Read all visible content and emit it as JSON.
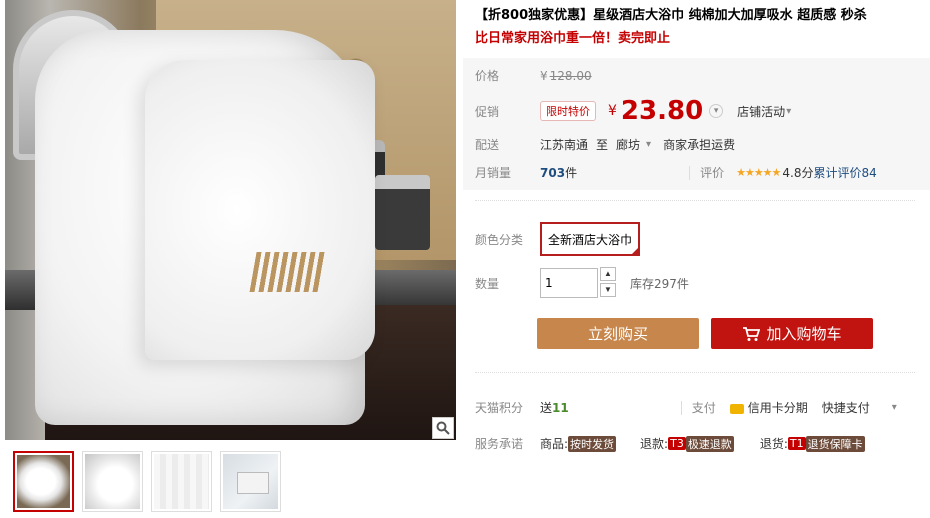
{
  "title": {
    "line1": "【折800独家优惠】星级酒店大浴巾 纯棉加大加厚吸水 超质感 秒杀",
    "line2": "比日常家用浴巾重一倍！卖完即止"
  },
  "price": {
    "label": "价格",
    "currency": "¥",
    "original": "128.00"
  },
  "promo": {
    "label": "促销",
    "badge": "限时特价",
    "currency": "¥",
    "value": "23.80",
    "store_activity": "店铺活动"
  },
  "shipping": {
    "label": "配送",
    "from": "江苏南通",
    "to_word": "至",
    "to": "廊坊",
    "fee": "商家承担运费"
  },
  "sales": {
    "label": "月销量",
    "count": "703",
    "unit": "件",
    "review_label": "评价",
    "stars": "★★★★★",
    "score": "4.8分",
    "review_count": "累计评价84"
  },
  "sku": {
    "label": "颜色分类",
    "option": "全新酒店大浴巾"
  },
  "quantity": {
    "label": "数量",
    "value": "1",
    "stock": "库存297件"
  },
  "actions": {
    "buy_now": "立刻购买",
    "add_cart": "加入购物车"
  },
  "points": {
    "label": "天猫积分",
    "prefix": "送",
    "value": "11",
    "pay_label": "支付",
    "credit": "信用卡分期",
    "quick_pay": "快捷支付"
  },
  "service": {
    "label": "服务承诺",
    "goods_prefix": "商品:",
    "goods_tag": "按时发货",
    "refund_prefix": "退款:",
    "refund_code": "T3",
    "refund_tag": "极速退款",
    "return_prefix": "退货:",
    "return_code": "T1",
    "return_tag": "退货保障卡"
  },
  "icons": [
    "zoom-icon",
    "cart-icon",
    "credit-card-icon",
    "chevron-down-icon"
  ]
}
